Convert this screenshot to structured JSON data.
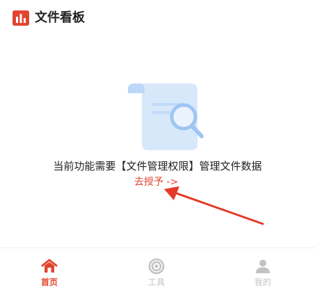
{
  "header": {
    "title": "文件看板",
    "logo_icon": "bar-chart-icon",
    "accent_color": "#e2452f"
  },
  "main": {
    "illustration_icon": "document-search-icon",
    "message": "当前功能需要【文件管理权限】管理文件数据",
    "auth_link": "去授予 ->"
  },
  "tabbar": {
    "active_color": "#e2452f",
    "inactive_color": "#c2c2c2",
    "tabs": [
      {
        "label": "首页",
        "icon": "home-icon",
        "active": true
      },
      {
        "label": "工具",
        "icon": "target-icon",
        "active": false
      },
      {
        "label": "我的",
        "icon": "user-icon",
        "active": false
      }
    ]
  }
}
